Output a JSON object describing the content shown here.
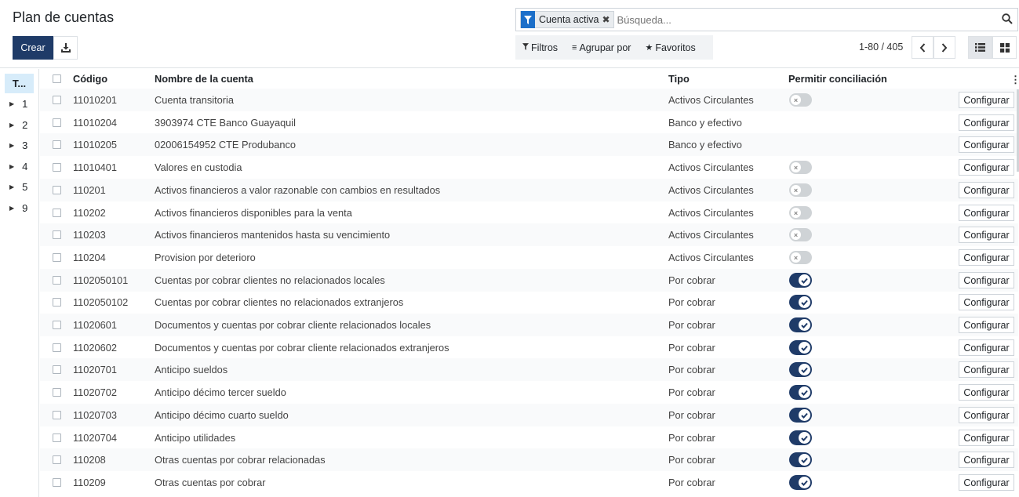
{
  "page": {
    "title": "Plan de cuentas"
  },
  "toolbar": {
    "create_label": "Crear"
  },
  "search": {
    "facet_label": "Cuenta activa",
    "placeholder": "Búsqueda..."
  },
  "filters": {
    "filters_label": "Filtros",
    "groupby_label": "Agrupar por",
    "favorites_label": "Favoritos"
  },
  "pager": {
    "value": "1-80 / 405"
  },
  "sidebar": {
    "header": "T...",
    "items": [
      "1",
      "2",
      "3",
      "4",
      "5",
      "9"
    ]
  },
  "table": {
    "columns": {
      "code": "Código",
      "name": "Nombre de la cuenta",
      "type": "Tipo",
      "reconcile": "Permitir conciliación"
    },
    "configure_label": "Configurar",
    "rows": [
      {
        "code": "11010201",
        "name": "Cuenta transitoria",
        "type": "Activos Circulantes",
        "reconcile": "off"
      },
      {
        "code": "11010204",
        "name": "3903974 CTE Banco Guayaquil",
        "type": "Banco y efectivo",
        "reconcile": "none"
      },
      {
        "code": "11010205",
        "name": "02006154952 CTE Produbanco",
        "type": "Banco y efectivo",
        "reconcile": "none"
      },
      {
        "code": "11010401",
        "name": "Valores en custodia",
        "type": "Activos Circulantes",
        "reconcile": "off"
      },
      {
        "code": "110201",
        "name": "Activos financieros a valor razonable con cambios en resultados",
        "type": "Activos Circulantes",
        "reconcile": "off"
      },
      {
        "code": "110202",
        "name": "Activos financieros disponibles para la venta",
        "type": "Activos Circulantes",
        "reconcile": "off"
      },
      {
        "code": "110203",
        "name": "Activos financieros mantenidos hasta su vencimiento",
        "type": "Activos Circulantes",
        "reconcile": "off"
      },
      {
        "code": "110204",
        "name": "Provision por deterioro",
        "type": "Activos Circulantes",
        "reconcile": "off"
      },
      {
        "code": "1102050101",
        "name": "Cuentas por cobrar clientes no relacionados locales",
        "type": "Por cobrar",
        "reconcile": "on"
      },
      {
        "code": "1102050102",
        "name": "Cuentas por cobrar clientes no relacionados extranjeros",
        "type": "Por cobrar",
        "reconcile": "on"
      },
      {
        "code": "11020601",
        "name": "Documentos y cuentas por cobrar cliente relacionados locales",
        "type": "Por cobrar",
        "reconcile": "on"
      },
      {
        "code": "11020602",
        "name": "Documentos y cuentas por cobrar cliente relacionados extranjeros",
        "type": "Por cobrar",
        "reconcile": "on"
      },
      {
        "code": "11020701",
        "name": "Anticipo sueldos",
        "type": "Por cobrar",
        "reconcile": "on"
      },
      {
        "code": "11020702",
        "name": "Anticipo décimo tercer sueldo",
        "type": "Por cobrar",
        "reconcile": "on"
      },
      {
        "code": "11020703",
        "name": "Anticipo décimo cuarto sueldo",
        "type": "Por cobrar",
        "reconcile": "on"
      },
      {
        "code": "11020704",
        "name": "Anticipo utilidades",
        "type": "Por cobrar",
        "reconcile": "on"
      },
      {
        "code": "110208",
        "name": "Otras cuentas por cobrar relacionadas",
        "type": "Por cobrar",
        "reconcile": "on"
      },
      {
        "code": "110209",
        "name": "Otras cuentas por cobrar",
        "type": "Por cobrar",
        "reconcile": "on"
      }
    ]
  },
  "colors": {
    "primary": "#1f3b68",
    "facet_accent": "#1c6fc9",
    "toggle_off": "#cfd3d6"
  },
  "icons": {
    "download": "download-icon",
    "filter": "funnel-icon",
    "search": "search-icon",
    "list_view": "list-view-icon",
    "kanban_view": "kanban-view-icon"
  }
}
